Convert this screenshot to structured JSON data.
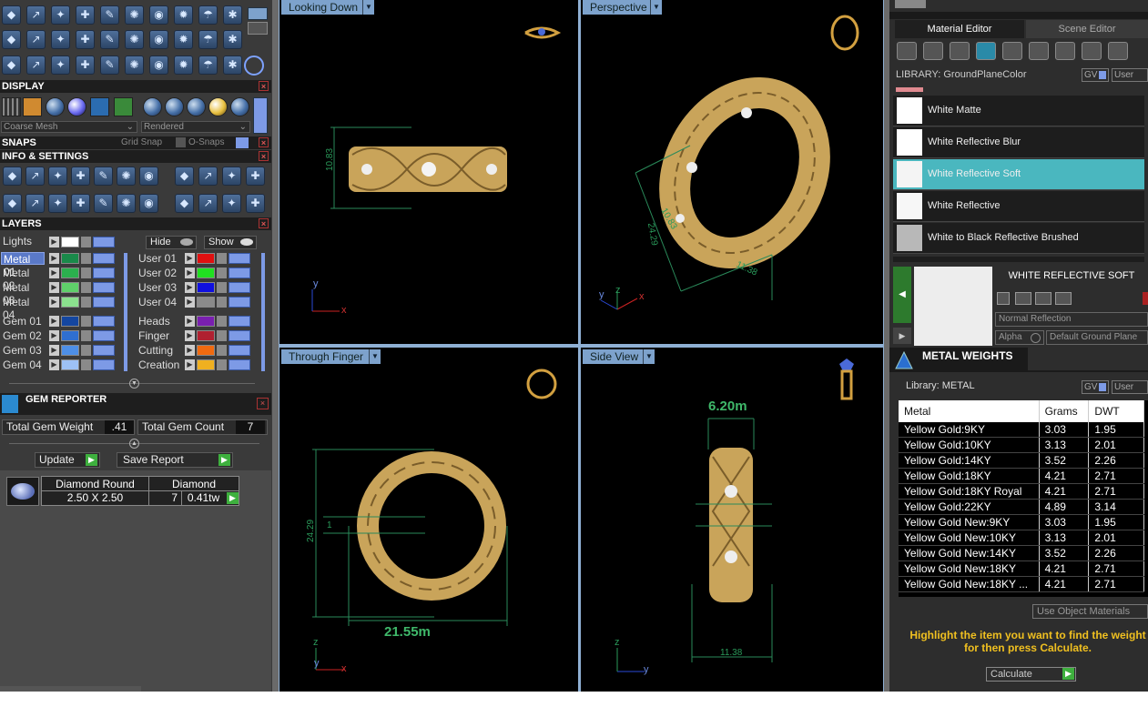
{
  "display": {
    "title": "DISPLAY",
    "mesh_select": "Coarse Mesh",
    "render_select": "Rendered"
  },
  "snaps": {
    "title": "SNAPS",
    "grid_snap": "Grid Snap",
    "o_snaps": "O-Snaps"
  },
  "info_settings": {
    "title": "INFO & SETTINGS"
  },
  "layers": {
    "title": "LAYERS",
    "lights_label": "Lights",
    "hide_label": "Hide",
    "show_label": "Show",
    "left_column": [
      {
        "label": "Metal 01",
        "color": "#1a8a4a",
        "selected": true
      },
      {
        "label": "Metal 02",
        "color": "#2bb04e"
      },
      {
        "label": "Metal 03",
        "color": "#5fd06a"
      },
      {
        "label": "Metal 04",
        "color": "#8be08e"
      },
      {
        "label": "Gem 01",
        "color": "#1446a0"
      },
      {
        "label": "Gem 02",
        "color": "#2f6fd0"
      },
      {
        "label": "Gem 03",
        "color": "#4e8fe6"
      },
      {
        "label": "Gem 04",
        "color": "#9dc1f5"
      }
    ],
    "right_column": [
      {
        "label": "User 01",
        "color": "#e01010"
      },
      {
        "label": "User 02",
        "color": "#20e020"
      },
      {
        "label": "User 03",
        "color": "#1010e0"
      },
      {
        "label": "User 04",
        "color": "#8a8a8a"
      },
      {
        "label": "Heads",
        "color": "#7a1fb0"
      },
      {
        "label": "Finger",
        "color": "#b02030"
      },
      {
        "label": "Cutting",
        "color": "#f06a10"
      },
      {
        "label": "Creation",
        "color": "#f0b020"
      }
    ]
  },
  "gem_reporter": {
    "title": "GEM REPORTER",
    "total_weight_label": "Total Gem Weight",
    "total_weight_value": ".41",
    "total_count_label": "Total Gem Count",
    "total_count_value": "7",
    "update_label": "Update",
    "save_report_label": "Save Report",
    "gem_name": "Diamond Round",
    "gem_material": "Diamond",
    "gem_size": "2.50 X 2.50",
    "gem_count": "7",
    "gem_tw": "0.41tw"
  },
  "viewports": {
    "top_left": {
      "label": "Looking Down",
      "dim_height": "10.83",
      "axis_a": "y",
      "axis_b": "x"
    },
    "top_right": {
      "label": "Perspective",
      "dim_a": "10.83",
      "dim_b": "24.29",
      "dim_c": "11.38",
      "axis_a": "y",
      "axis_b": "z",
      "axis_c": "x"
    },
    "bottom_left": {
      "label": "Through Finger",
      "dim_height": "24.29",
      "dim_small": "1",
      "dim_width": "21.55m",
      "axis_a": "z",
      "axis_b": "y",
      "axis_c": "x"
    },
    "bottom_right": {
      "label": "Side View",
      "dim_top": "6.20m",
      "dim_bottom": "11.38",
      "axis_a": "z",
      "axis_b": "y"
    }
  },
  "material_editor": {
    "tab_active": "Material Editor",
    "tab_inactive": "Scene Editor",
    "library_label": "LIBRARY: GroundPlaneColor",
    "gv_label": "GV",
    "user_label": "User",
    "materials": [
      {
        "name": "White Matte",
        "swatch": "#ffffff"
      },
      {
        "name": "White Reflective Blur",
        "swatch": "#ffffff"
      },
      {
        "name": "White Reflective Soft",
        "swatch": "#f4f4f4",
        "selected": true
      },
      {
        "name": "White Reflective",
        "swatch": "#f7f7f7"
      },
      {
        "name": "White to Black Reflective Brushed",
        "swatch": "#b8b8b8"
      }
    ],
    "preview_title": "WHITE REFLECTIVE SOFT",
    "reflection_select": "Normal Reflection",
    "alpha_label": "Alpha",
    "ground_select": "Default Ground Plane"
  },
  "metal_weights": {
    "title": "METAL WEIGHTS",
    "library_label": "Library: METAL",
    "gv_label": "GV",
    "user_label": "User",
    "columns": [
      "Metal",
      "Grams",
      "DWT"
    ],
    "rows": [
      [
        "Yellow Gold:9KY",
        "3.03",
        "1.95"
      ],
      [
        "Yellow Gold:10KY",
        "3.13",
        "2.01"
      ],
      [
        "Yellow Gold:14KY",
        "3.52",
        "2.26"
      ],
      [
        "Yellow Gold:18KY",
        "4.21",
        "2.71"
      ],
      [
        "Yellow Gold:18KY Royal",
        "4.21",
        "2.71"
      ],
      [
        "Yellow Gold:22KY",
        "4.89",
        "3.14"
      ],
      [
        "Yellow Gold New:9KY",
        "3.03",
        "1.95"
      ],
      [
        "Yellow Gold New:10KY",
        "3.13",
        "2.01"
      ],
      [
        "Yellow Gold New:14KY",
        "3.52",
        "2.26"
      ],
      [
        "Yellow Gold New:18KY",
        "4.21",
        "2.71"
      ],
      [
        "Yellow Gold New:18KY ...",
        "4.21",
        "2.71"
      ]
    ],
    "use_object_materials": "Use Object Materials",
    "hint": "Highlight the item you want to find the weight for then press Calculate.",
    "calculate_label": "Calculate"
  }
}
